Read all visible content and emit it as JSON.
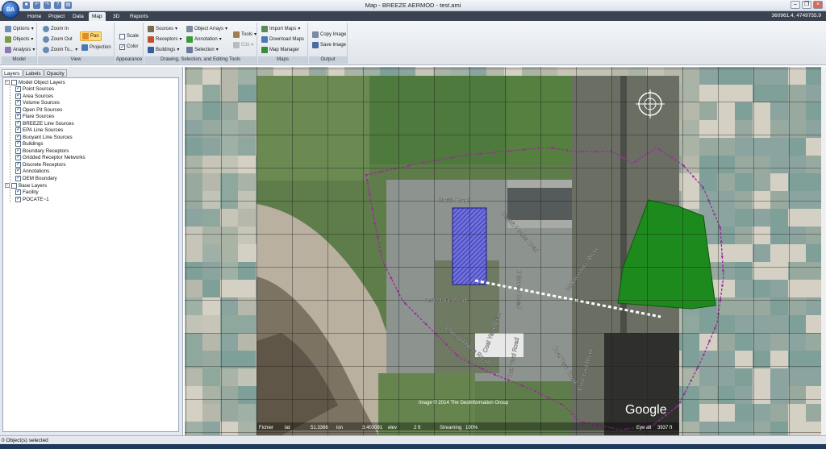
{
  "window": {
    "title": "Map - BREEZE AERMOD - test.ami",
    "app_orb": "BA",
    "coordinates": "360961.4, 4749755.9"
  },
  "tabs": [
    "Home",
    "Project",
    "Data",
    "Map",
    "3D",
    "Reports"
  ],
  "active_tab": "Map",
  "ribbon": {
    "model": {
      "caption": "Model",
      "options": "Options",
      "objects": "Objects",
      "analysis": "Analysis"
    },
    "view": {
      "caption": "View",
      "zoom_in": "Zoom In",
      "zoom_out": "Zoom Out",
      "zoom_to": "Zoom To...",
      "pan": "Pan",
      "projection": "Projection"
    },
    "appearance": {
      "caption": "Appearance",
      "scale": "Scale",
      "color": "Color"
    },
    "drawing": {
      "caption": "Drawing, Selection, and Editing Tools",
      "sources": "Sources",
      "receptors": "Receptors",
      "buildings": "Buildings",
      "object_arrays": "Object Arrays",
      "annotation": "Annotation",
      "selection": "Selection",
      "tools": "Tools",
      "edit": "Edit"
    },
    "maps": {
      "caption": "Maps",
      "import_maps": "Import Maps",
      "download_maps": "Download Maps",
      "map_manager": "Map Manager"
    },
    "output": {
      "caption": "Output",
      "copy_image": "Copy Image",
      "save_image": "Save Image"
    }
  },
  "panel_tabs": [
    "Layers",
    "Labels",
    "Opacity"
  ],
  "layers": {
    "model_group": "Model Object Layers",
    "model_items": [
      "Point Sources",
      "Area Sources",
      "Volume Sources",
      "Open Pit Sources",
      "Flare Sources",
      "BREEZE Line Sources",
      "EPA Line Sources",
      "Buoyant Line Sources",
      "Buildings",
      "Boundary Receptors",
      "Gridded Receptor Networks",
      "Discrete Receptors",
      "Annotations",
      "DEM Boundary"
    ],
    "base_group": "Base Layers",
    "base_items": [
      "Facility",
      "POCATE~1"
    ]
  },
  "map": {
    "road_labels": [
      "North Road",
      "Switch House Road",
      "Chimney Road",
      "Maintenance Road",
      "Ash Plant Road",
      "Control House Road",
      "Coal Yard Road",
      "Coal Yard Road",
      "Coal Yard Road",
      "Coal Yard Road"
    ],
    "copyright": "Image © 2014 The GeoInformation Group",
    "google": "Google",
    "eye_alt": "Eye alt",
    "eye_alt_value": "3937 ft",
    "status_bits": [
      "Fichier",
      "lat",
      "51.3386",
      "lon",
      "3.403091",
      "elev",
      "2 ft",
      "Streaming",
      "100%"
    ]
  },
  "status": "0 Object(s) selected",
  "colors": {
    "green_area": "#1d8a1d",
    "boundary": "#9a2d9a",
    "building": "#4a4ad0"
  }
}
